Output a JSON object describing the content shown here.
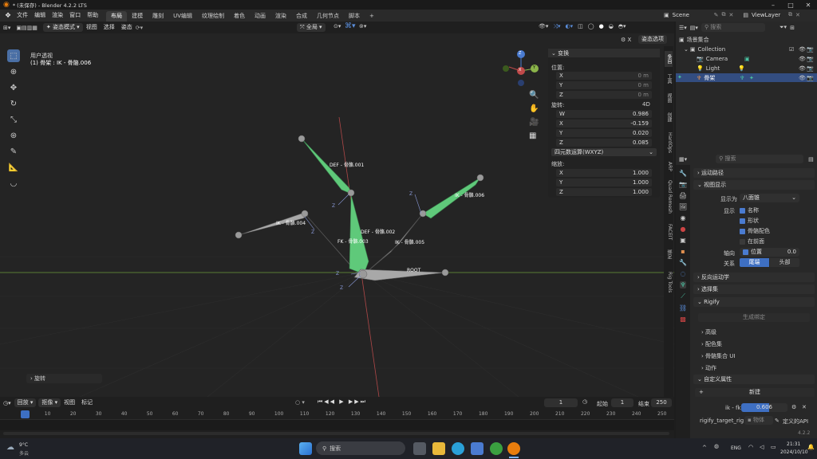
{
  "window": {
    "title": "* (未保存) - Blender 4.2.2 LTS"
  },
  "menubar": {
    "menus": [
      "文件",
      "编辑",
      "渲染",
      "窗口",
      "帮助"
    ],
    "workspaces": [
      "布局",
      "建模",
      "雕刻",
      "UV编辑",
      "纹理绘制",
      "着色",
      "动画",
      "渲染",
      "合成",
      "几何节点",
      "脚本"
    ],
    "add_tab": "+",
    "scene": "Scene",
    "view_layer": "ViewLayer"
  },
  "viewport_header": {
    "mode": "姿态模式",
    "menus": [
      "视图",
      "选择",
      "姿态"
    ],
    "orientation": "全局",
    "pose_options": "姿态选项"
  },
  "viewport": {
    "view_name": "用户透视",
    "active_label": "(1) 骨架 : IK - 骨骼.006",
    "bone_labels": [
      "DEF - 骨骼.001",
      "IK - 骨骼.004",
      "DEF - 骨骼.002",
      "FK - 骨骼.003",
      "IK - 骨骼.005",
      "IK - 骨骼.006",
      "ROOT"
    ],
    "axis_labels": [
      "Z",
      "Z",
      "Z",
      "Z",
      "Z"
    ],
    "gizmo": {
      "x": "X",
      "y": "Y",
      "z": "Z"
    },
    "last_op": "旋转",
    "colors": {
      "bone_green": "#5fc97a",
      "bone_grey": "#a8a8a8",
      "x_axis": "#b04848",
      "y_axis": "#6a9a3a"
    }
  },
  "npanel": {
    "header": "变换",
    "location_label": "位置:",
    "location": [
      {
        "axis": "X",
        "value": "0 m"
      },
      {
        "axis": "Y",
        "value": "0 m"
      },
      {
        "axis": "Z",
        "value": "0 m"
      }
    ],
    "rotation_label": "旋转:",
    "rotation_mode_short": "4D",
    "rotation": [
      {
        "axis": "W",
        "value": "0.986"
      },
      {
        "axis": "X",
        "value": "-0.159"
      },
      {
        "axis": "Y",
        "value": "0.020"
      },
      {
        "axis": "Z",
        "value": "0.085"
      }
    ],
    "rotation_mode": "四元数运算(WXYZ)",
    "scale_label": "缩放:",
    "scale": [
      {
        "axis": "X",
        "value": "1.000"
      },
      {
        "axis": "Y",
        "value": "1.000"
      },
      {
        "axis": "Z",
        "value": "1.000"
      }
    ]
  },
  "side_tabs": [
    "条目",
    "工具",
    "视图",
    "创建",
    "HardOps",
    "ARP",
    "Quad Remesh",
    "FACEIT",
    "绑定",
    "Rig Tools"
  ],
  "outliner": {
    "search_placeholder": "搜索",
    "root": "场景集合",
    "collection": "Collection",
    "items": [
      "Camera",
      "Light",
      "骨架"
    ]
  },
  "properties": {
    "search_placeholder": "搜索",
    "motion_paths": "运动路径",
    "viewport_display": "视图显示",
    "display_as_label": "显示为",
    "display_as": "八面锥",
    "show_label": "显示",
    "show_name": "名称",
    "show_shape": "形状",
    "show_bone_colors": "骨骼配色",
    "in_front": "在前面",
    "axes_label": "轴向",
    "axes_position_label": "位置",
    "axes_position": "0.0",
    "relations_label": "关系",
    "relation_tail": "尾端",
    "relation_head": "头部",
    "ik": "反向运动学",
    "selection_sets": "选择集",
    "rigify": "Rigify",
    "generate_rig": "生成绑定",
    "advanced": "高级",
    "color_sets": "配色集",
    "bone_collection_ui": "骨骼集合 UI",
    "actions": "动作",
    "custom_props": "自定义属性",
    "new": "新建",
    "ik_fk_label": "ik - fk",
    "ik_fk_value": "0.606",
    "rigify_target_rig": "rigify_target_rig",
    "object_label": "物体",
    "api_defined": "定义的API",
    "version": "4.2.2"
  },
  "timeline": {
    "menus": [
      "回放",
      "抠像",
      "视图",
      "标记"
    ],
    "current_frame": "1",
    "start_label": "起始",
    "start": "1",
    "end_label": "结束",
    "end": "250",
    "ticks": [
      "1",
      "10",
      "20",
      "30",
      "40",
      "50",
      "60",
      "70",
      "80",
      "90",
      "100",
      "110",
      "120",
      "130",
      "140",
      "150",
      "160",
      "170",
      "180",
      "190",
      "200",
      "210",
      "220",
      "230",
      "240",
      "250"
    ]
  },
  "taskbar": {
    "weather_temp": "9°C",
    "weather_desc": "多云",
    "search": "搜索",
    "lang": "ENG",
    "time": "21:31",
    "date": "2024/10/10"
  }
}
